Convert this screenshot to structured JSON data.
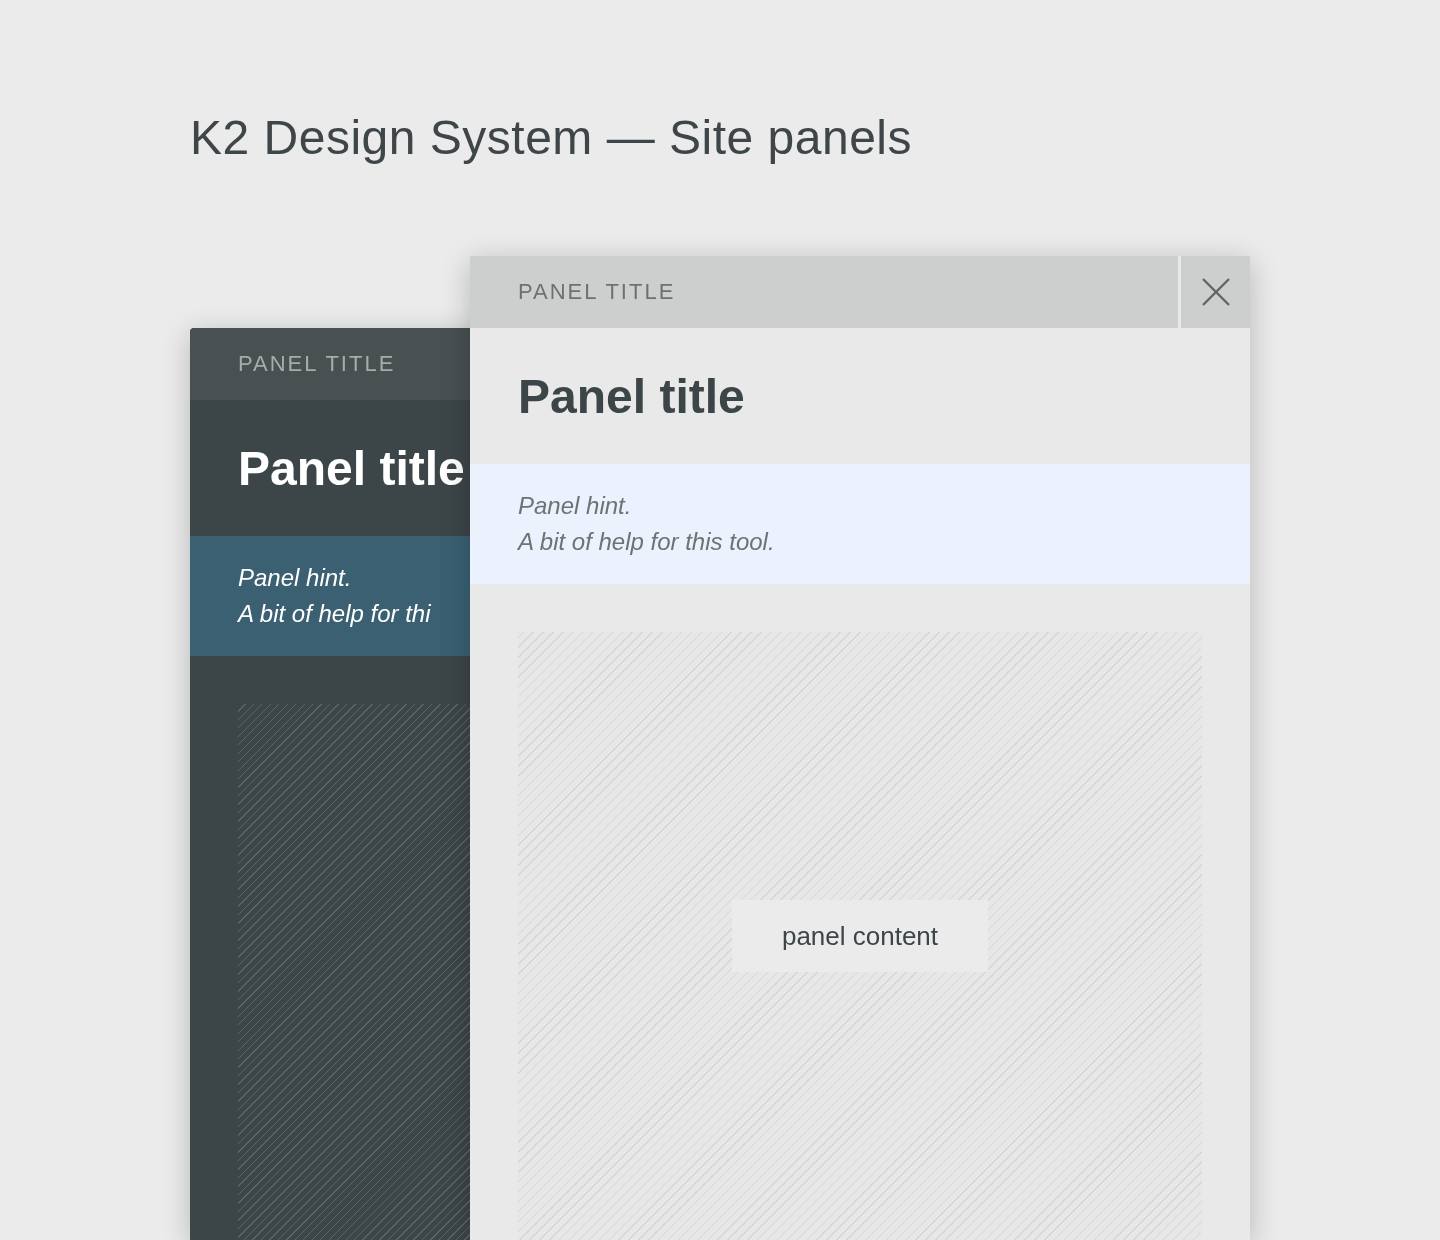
{
  "page_title": "K2 Design System — Site panels",
  "panels": [
    {
      "kind": "dark",
      "header": "PANEL TITLE",
      "title": "Panel title",
      "hint": [
        "Panel hint.",
        "A bit of help for thi"
      ]
    },
    {
      "kind": "light",
      "header": "PANEL TITLE",
      "title": "Panel title",
      "hint": [
        "Panel hint.",
        "A bit of help for this tool."
      ],
      "content_label": "panel content",
      "closable": true
    }
  ]
}
